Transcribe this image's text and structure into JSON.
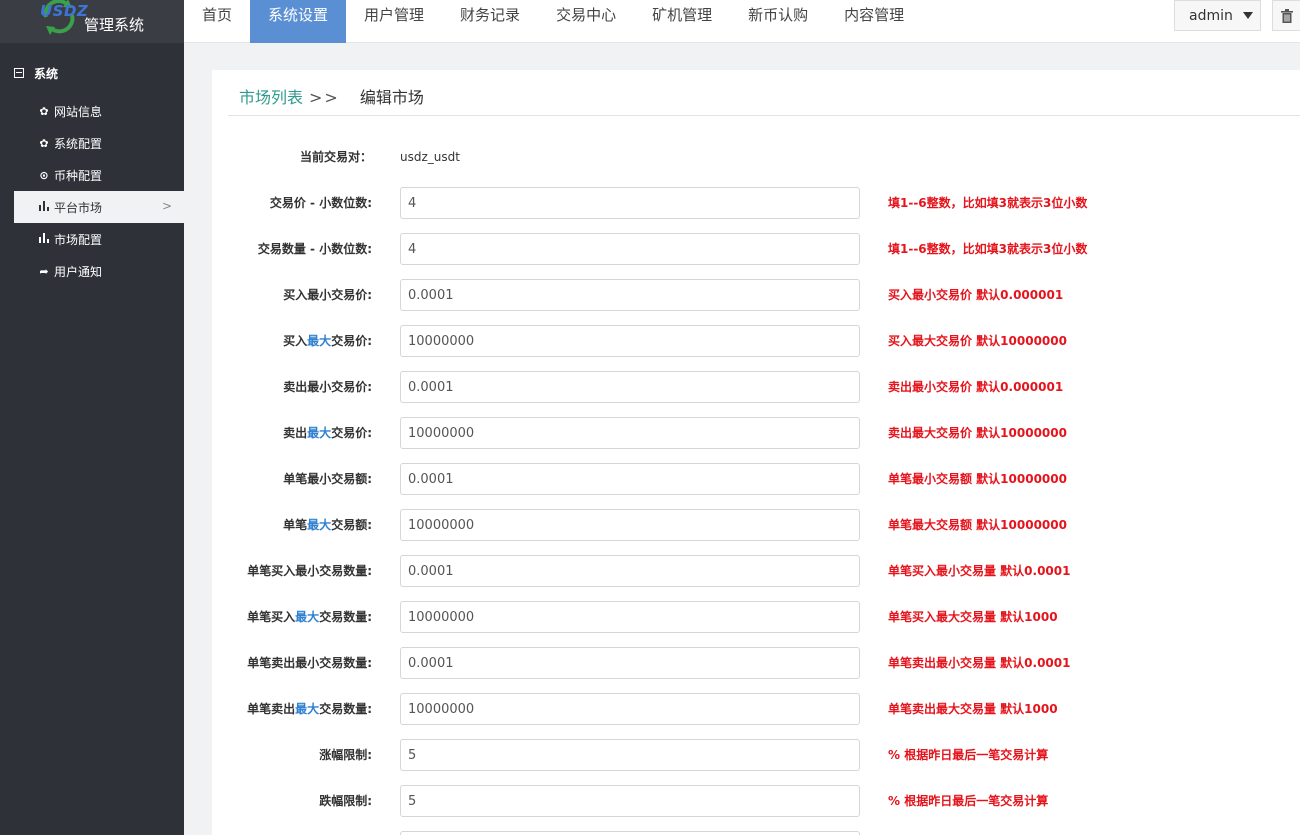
{
  "app": {
    "logo_text": "USDZ",
    "title": "管理系统"
  },
  "nav": {
    "items": [
      "首页",
      "系统设置",
      "用户管理",
      "财务记录",
      "交易中心",
      "矿机管理",
      "新币认购",
      "内容管理"
    ],
    "active_index": 1,
    "user": "admin"
  },
  "sidebar": {
    "section": "系统",
    "items": [
      {
        "label": "网站信息",
        "icon": "gear-icon"
      },
      {
        "label": "系统配置",
        "icon": "gear-icon"
      },
      {
        "label": "币种配置",
        "icon": "circle-dot-icon"
      },
      {
        "label": "平台市场",
        "icon": "bar-chart-icon"
      },
      {
        "label": "市场配置",
        "icon": "bar-chart-icon"
      },
      {
        "label": "用户通知",
        "icon": "share-arrow-icon"
      }
    ],
    "active_index": 3
  },
  "breadcrumb": {
    "link": "市场列表",
    "separator": ">>",
    "current": "编辑市场"
  },
  "form": {
    "pair_label": "当前交易对：",
    "pair_value": "usdz_usdt",
    "fields": [
      {
        "label": "交易价 - 小数位数:",
        "value": "4",
        "hint": "填1--6整数，比如填3就表示3位小数"
      },
      {
        "label": "交易数量 - 小数位数:",
        "value": "4",
        "hint": "填1--6整数，比如填3就表示3位小数"
      },
      {
        "label": "买入最小交易价:",
        "value": "0.0001",
        "hint": "买入最小交易价 默认0.000001"
      },
      {
        "label_pre": "买入",
        "label_hl": "最大",
        "label_post": "交易价:",
        "value": "10000000",
        "hint": "买入最大交易价 默认10000000"
      },
      {
        "label": "卖出最小交易价:",
        "value": "0.0001",
        "hint": "卖出最小交易价 默认0.000001"
      },
      {
        "label_pre": "卖出",
        "label_hl": "最大",
        "label_post": "交易价:",
        "value": "10000000",
        "hint": "卖出最大交易价 默认10000000"
      },
      {
        "label": "单笔最小交易额:",
        "value": "0.0001",
        "hint": "单笔最小交易额 默认10000000"
      },
      {
        "label_pre": "单笔",
        "label_hl": "最大",
        "label_post": "交易额:",
        "value": "10000000",
        "hint": "单笔最大交易额 默认10000000"
      },
      {
        "label": "单笔买入最小交易数量:",
        "value": "0.0001",
        "hint": "单笔买入最小交易量 默认0.0001"
      },
      {
        "label_pre": "单笔买入",
        "label_hl": "最大",
        "label_post": "交易数量:",
        "value": "10000000",
        "hint": "单笔买入最大交易量 默认1000"
      },
      {
        "label": "单笔卖出最小交易数量:",
        "value": "0.0001",
        "hint": "单笔卖出最小交易量 默认0.0001"
      },
      {
        "label_pre": "单笔卖出",
        "label_hl": "最大",
        "label_post": "交易数量:",
        "value": "10000000",
        "hint": "单笔卖出最大交易量 默认1000"
      },
      {
        "label": "涨幅限制:",
        "value": "5",
        "hint": "% 根据昨日最后一笔交易计算"
      },
      {
        "label": "跌幅限制:",
        "value": "5",
        "hint": "% 根据昨日最后一笔交易计算"
      }
    ]
  },
  "colors": {
    "sidebar_bg": "#2e3138",
    "nav_active": "#5b8fd4",
    "breadcrumb_link": "#2e9b8c",
    "hint_red": "#e5141c",
    "label_highlight": "#2f80d1"
  }
}
